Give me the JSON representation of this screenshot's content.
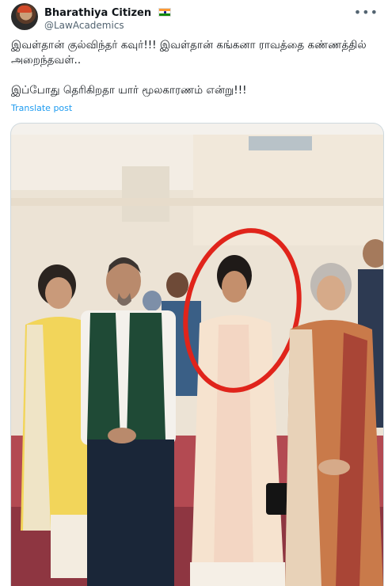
{
  "post": {
    "author": {
      "display_name": "Bharathiya Citizen",
      "handle": "@LawAcademics",
      "flag_icon": "india-flag-icon",
      "avatar_icon": "avatar"
    },
    "more_icon": "more-options-icon",
    "text_line_1": "இவள்தான் குல்விந்தர் கவுர்!!! இவள்தான் கங்கனா ராவத்தை கண்ணத்தில் அறைந்தவள்..",
    "text_line_2": "இப்போது தெரிகிறதா யார் மூலகாரணம் என்று!!!",
    "translate_label": "Translate post"
  },
  "colors": {
    "text_primary": "#0f1419",
    "text_secondary": "#536471",
    "link": "#1d9bf0",
    "border": "#cfd9de",
    "annotation_circle": "#e0241b"
  }
}
